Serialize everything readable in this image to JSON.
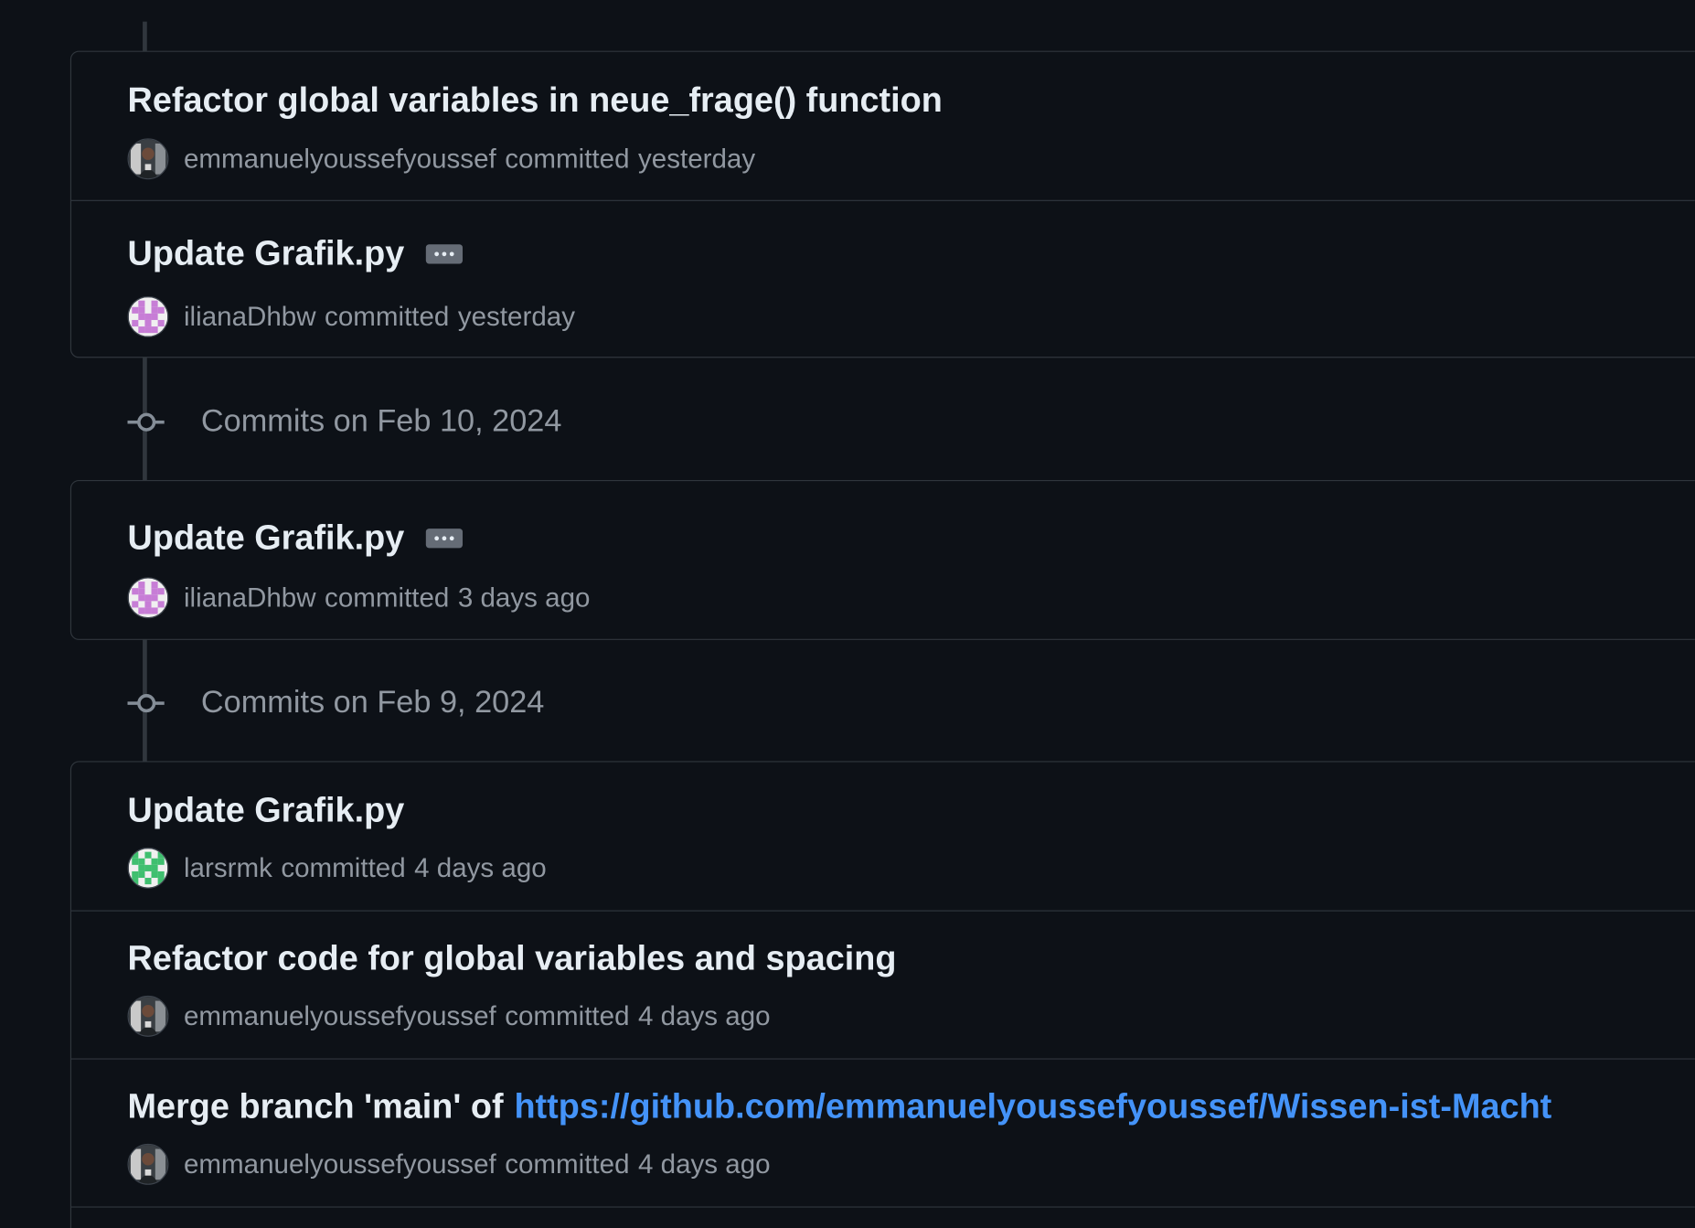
{
  "groups": [
    {
      "title": "",
      "commits": [
        {
          "title": "Refactor global variables in neue_frage() function",
          "author": "emmanuelyoussefyoussef",
          "verb": "committed",
          "time": "yesterday",
          "avatar": "photo-avatar"
        },
        {
          "title": "Update Grafik.py",
          "author": "ilianaDhbw",
          "verb": "committed",
          "time": "yesterday",
          "avatar": "identicon-pink"
        }
      ]
    },
    {
      "title": "Commits on Feb 10, 2024",
      "commits": [
        {
          "title": "Update Grafik.py",
          "author": "ilianaDhbw",
          "verb": "committed",
          "time": "3 days ago",
          "avatar": "identicon-pink"
        }
      ]
    },
    {
      "title": "Commits on Feb 9, 2024",
      "commits": [
        {
          "title": "Update Grafik.py",
          "author": "larsrmk",
          "verb": "committed",
          "time": "4 days ago",
          "avatar": "identicon-green"
        },
        {
          "title": "Refactor code for global variables and spacing",
          "author": "emmanuelyoussefyoussef",
          "verb": "committed",
          "time": "4 days ago",
          "avatar": "photo-avatar"
        },
        {
          "title": "Merge branch 'main' of",
          "link": "https://github.com/emmanuelyoussefyoussef/Wissen-ist-Macht",
          "author": "emmanuelyoussefyoussef",
          "verb": "committed",
          "time": "4 days ago",
          "avatar": "photo-avatar"
        }
      ]
    }
  ],
  "colors": {
    "background": "#0d1117",
    "border": "#30363d",
    "text_primary": "#e6edf3",
    "text_muted": "#9198a1",
    "link": "#4493f8"
  }
}
